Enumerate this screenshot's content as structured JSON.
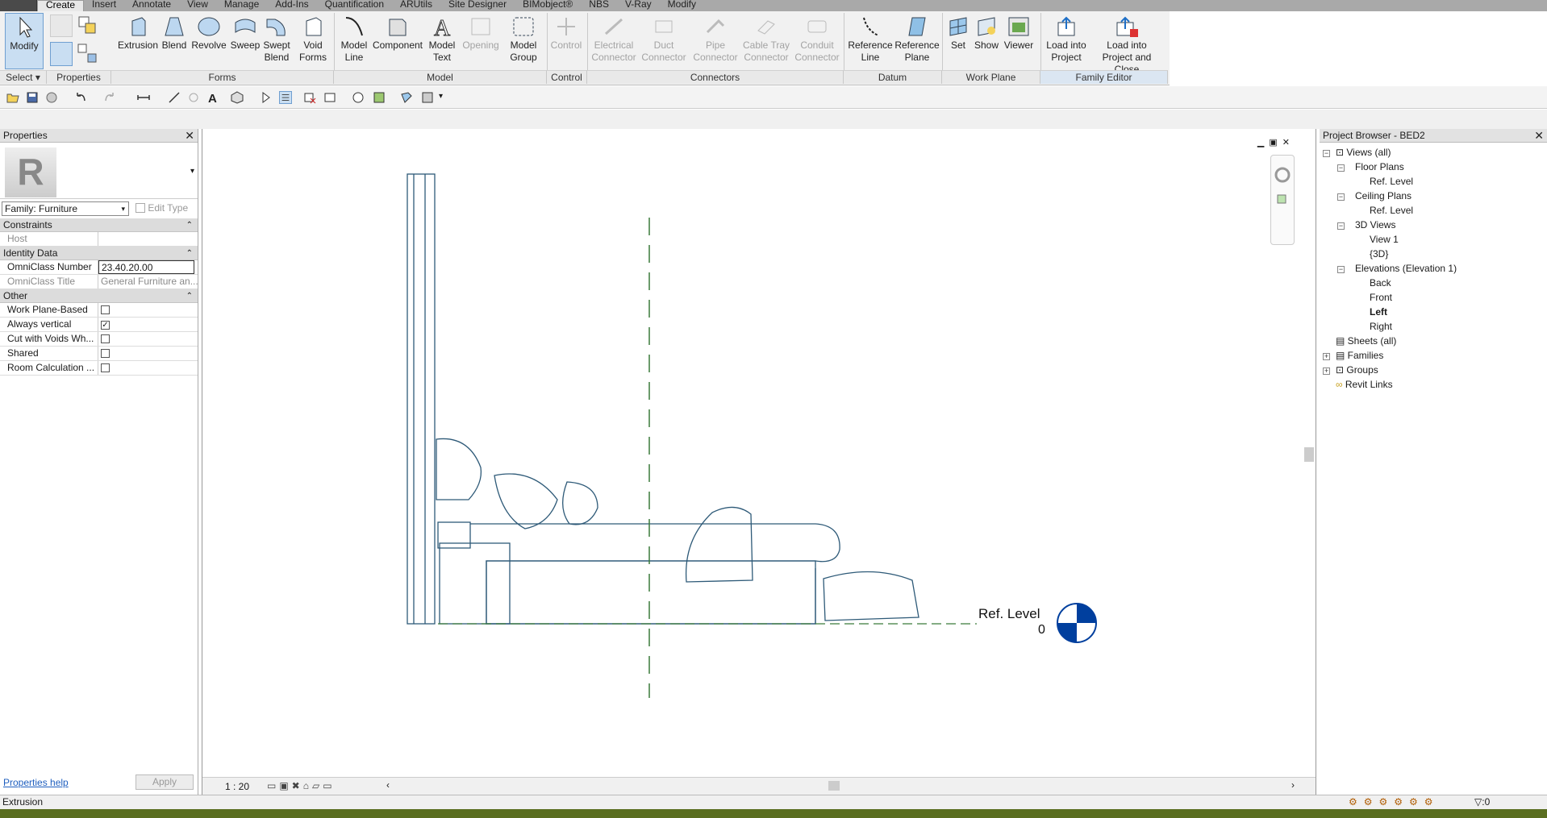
{
  "menu_tabs": [
    "Create",
    "Insert",
    "Annotate",
    "View",
    "Manage",
    "Add-Ins",
    "Quantification",
    "ARUtils",
    "Site Designer",
    "BIMobject®",
    "NBS",
    "V-Ray",
    "Modify"
  ],
  "ribbon": {
    "select_tool": "Modify",
    "select_panel": "Select",
    "properties_panel": "Properties",
    "forms": {
      "panel": "Forms",
      "extrusion": "Extrusion",
      "blend": "Blend",
      "revolve": "Revolve",
      "sweep": "Sweep",
      "swept_blend": "Swept Blend",
      "void_forms": "Void Forms"
    },
    "model": {
      "panel": "Model",
      "model_line": "Model Line",
      "component": "Component",
      "model_text": "Model Text",
      "opening": "Opening",
      "model_group": "Model Group"
    },
    "control": {
      "panel": "Control",
      "control": "Control"
    },
    "connectors": {
      "panel": "Connectors",
      "electrical": "Electrical Connector",
      "duct": "Duct Connector",
      "pipe": "Pipe Connector",
      "cable_tray": "Cable Tray Connector",
      "conduit": "Conduit Connector"
    },
    "datum": {
      "panel": "Datum",
      "ref_line": "Reference Line",
      "ref_plane": "Reference Plane"
    },
    "work_plane": {
      "panel": "Work Plane",
      "set": "Set",
      "show": "Show",
      "viewer": "Viewer"
    },
    "family_editor": {
      "panel": "Family Editor",
      "load_project": "Load into Project",
      "load_close": "Load into Project and Close"
    }
  },
  "properties": {
    "title": "Properties",
    "type_selector": "Family: Furniture",
    "edit_type": "Edit Type",
    "groups": {
      "constraints": "Constraints",
      "identity": "Identity Data",
      "other": "Other"
    },
    "host_label": "Host",
    "omniclass_number_label": "OmniClass Number",
    "omniclass_number": "23.40.20.00",
    "omniclass_title_label": "OmniClass Title",
    "omniclass_title": "General Furniture an...",
    "work_plane_based": "Work Plane-Based",
    "always_vertical": "Always vertical",
    "cut_with_voids": "Cut with Voids Wh...",
    "shared": "Shared",
    "room_calc": "Room Calculation ...",
    "help": "Properties help",
    "apply": "Apply"
  },
  "canvas": {
    "level_name": "Ref. Level",
    "level_value": "0",
    "scale": "1 : 20"
  },
  "browser": {
    "title": "Project Browser - BED2",
    "views_all": "Views (all)",
    "floor_plans": "Floor Plans",
    "fp_ref": "Ref. Level",
    "ceiling_plans": "Ceiling Plans",
    "cp_ref": "Ref. Level",
    "views_3d": "3D Views",
    "view1": "View 1",
    "view3d": "{3D}",
    "elevations": "Elevations (Elevation 1)",
    "back": "Back",
    "front": "Front",
    "left": "Left",
    "right": "Right",
    "sheets": "Sheets (all)",
    "families": "Families",
    "groups": "Groups",
    "revit_links": "Revit Links"
  },
  "status_text": "Extrusion",
  "status_filter_count": ":0"
}
